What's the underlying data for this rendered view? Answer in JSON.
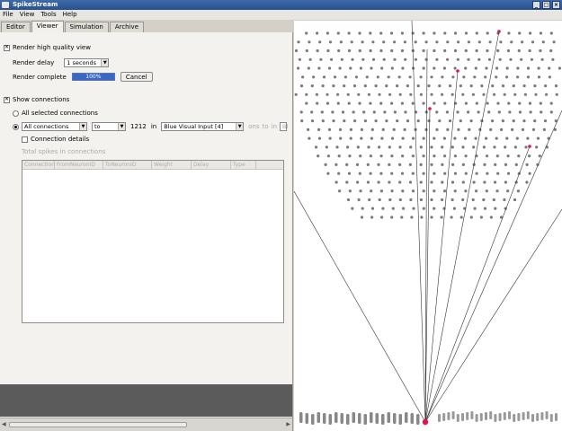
{
  "window": {
    "title": "SpikeStream"
  },
  "menu": [
    "File",
    "View",
    "Tools",
    "Help"
  ],
  "tabs": [
    {
      "label": "Editor",
      "active": false
    },
    {
      "label": "Viewer",
      "active": true
    },
    {
      "label": "Simulation",
      "active": false
    },
    {
      "label": "Archive",
      "active": false
    }
  ],
  "render": {
    "hq_label": "Render high quality view",
    "hq_checked": true,
    "delay_label": "Render delay",
    "delay_value": "1 seconds",
    "complete_label": "Render complete",
    "progress_text": "100%",
    "progress_fraction": 1.0,
    "cancel_label": "Cancel"
  },
  "connections": {
    "show_label": "Show connections",
    "show_checked": true,
    "all_selected_label": "All selected connections",
    "filter_value": "All connections",
    "to_value": "to",
    "count": "1212",
    "in_label": "in",
    "layer_value": "Blue Visual Input [4]",
    "extra_fields": [
      "ons",
      "to",
      "in",
      "Bl"
    ],
    "details_label": "Connection details",
    "table_caption": "Total spikes in connections",
    "columns": [
      "ConnectionID",
      "FromNeuronID",
      "ToNeuronID",
      "Weight",
      "Delay",
      "Type"
    ]
  },
  "colors": {
    "accent": "#3a66c4",
    "highlight_neuron": "#e0154d",
    "neuron": "#7a7a7a"
  }
}
